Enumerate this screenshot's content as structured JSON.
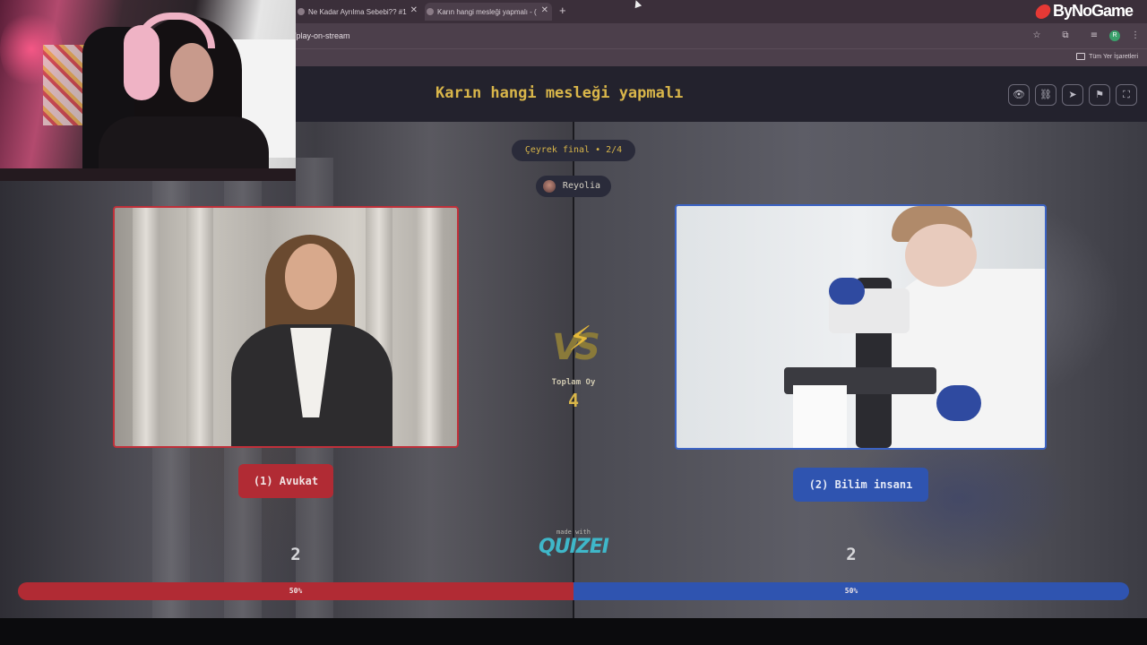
{
  "browser": {
    "tabs": [
      {
        "title": "Ne Kadar Ayrılma Sebebi?? #1"
      },
      {
        "title": "Karın hangi mesleği yapmalı - ("
      }
    ],
    "new_tab": "+",
    "url": "/play-on-stream",
    "bookmarks_label": "Tüm Yer İşaretleri",
    "profile_initial": "R"
  },
  "overlay": {
    "brand": "ByNoGame"
  },
  "quiz": {
    "title": "Karın hangi mesleği yapmalı",
    "round": "Çeyrek final • 2/4",
    "user": "Reyolia",
    "total_label": "Toplam Oy",
    "total_votes": 4,
    "vs": "VS",
    "made_with": "made with",
    "logo_text": "QUIZEI",
    "left": {
      "label": "(1) Avukat",
      "votes": 2,
      "percent": 50,
      "percent_label": "50%",
      "color": "#b12b34"
    },
    "right": {
      "label": "(2) Bilim insanı",
      "votes": 2,
      "percent": 50,
      "percent_label": "50%",
      "color": "#2f54b0"
    }
  },
  "header_icons": [
    "eye-icon",
    "link-icon",
    "send-icon",
    "flag-icon",
    "fullscreen-icon"
  ],
  "colors": {
    "accent": "#d9b64a",
    "left": "#b12b34",
    "right": "#2f54b0"
  }
}
